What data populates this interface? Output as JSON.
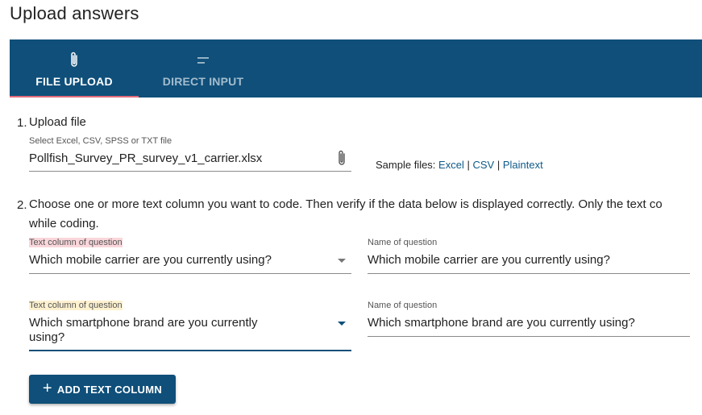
{
  "page": {
    "title": "Upload answers"
  },
  "tabs": [
    {
      "label": "FILE UPLOAD",
      "icon": "paperclip-icon",
      "active": true
    },
    {
      "label": "DIRECT INPUT",
      "icon": "text-lines-icon",
      "active": false
    }
  ],
  "step1": {
    "number": "1.",
    "title": "Upload file",
    "file_label": "Select Excel, CSV, SPSS or TXT file",
    "file_value": "Pollfish_Survey_PR_survey_v1_carrier.xlsx",
    "sample_prefix": "Sample files:",
    "samples": [
      "Excel",
      "CSV",
      "Plaintext"
    ],
    "separator": "|"
  },
  "step2": {
    "number": "2.",
    "text_line1": "Choose one or more text column you want to code. Then verify if the data below is displayed correctly. Only the text co",
    "text_line2": "while coding."
  },
  "columns": [
    {
      "column_label": "Text column of question",
      "column_value": "Which mobile carrier are you currently using?",
      "name_label": "Name of question",
      "name_value": "Which mobile carrier are you currently using?"
    },
    {
      "column_label": "Text column of question",
      "column_value_line1": "Which smartphone brand are you currently",
      "column_value_line2": "using?",
      "name_label": "Name of question",
      "name_value": "Which smartphone brand are you currently using?"
    }
  ],
  "add_button": {
    "label": "ADD TEXT COLUMN",
    "icon": "plus-icon"
  },
  "colors": {
    "primary": "#0f4f7a",
    "tab_indicator": "#e36b7a",
    "link": "#0f5a8a"
  }
}
